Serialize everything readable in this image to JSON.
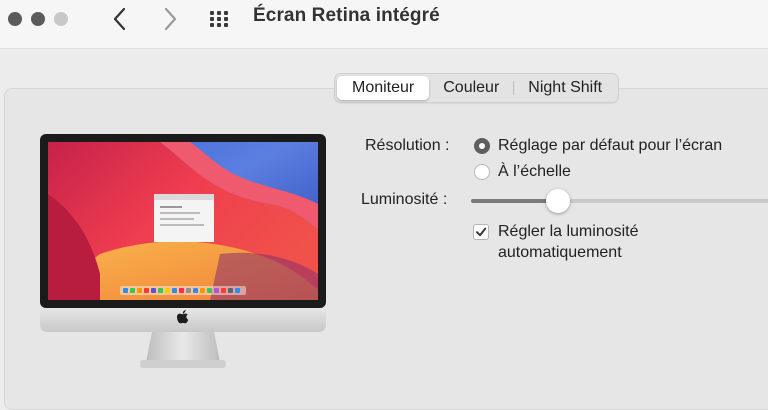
{
  "window": {
    "title": "Écran Retina intégré",
    "traffic_lights": [
      "close",
      "minimize",
      "zoom"
    ],
    "nav_back_icon": "chevron-left-icon",
    "nav_forward_icon": "chevron-right-icon",
    "show_all_icon": "grid-icon"
  },
  "tabs": [
    {
      "label": "Moniteur",
      "selected": true
    },
    {
      "label": "Couleur",
      "selected": false
    },
    {
      "label": "Night Shift",
      "selected": false
    }
  ],
  "resolution": {
    "label": "Résolution :",
    "options": [
      {
        "label": "Réglage par défaut pour l’écran",
        "selected": true
      },
      {
        "label": "À l’échelle",
        "selected": false
      }
    ]
  },
  "brightness": {
    "label": "Luminosité :",
    "level": 0.29
  },
  "auto_brightness": {
    "label_line1": "Régler la luminosité",
    "label_line2": "automatiquement",
    "checked": true
  },
  "colors": {
    "accent_gray": "#5e5e5e",
    "wallpaper_red": "#e8364a",
    "wallpaper_orange": "#f7a13a",
    "wallpaper_blue": "#2e5bd6"
  }
}
